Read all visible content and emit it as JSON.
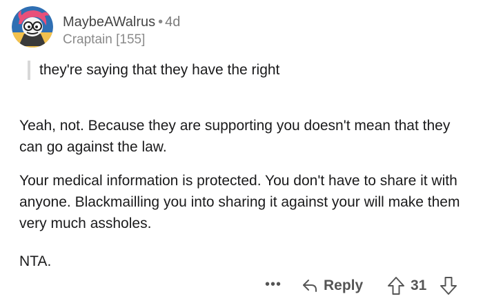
{
  "comment": {
    "author": {
      "username": "MaybeAWalrus",
      "separator": "•",
      "age": "4d",
      "flair": "Craptain [155]"
    },
    "quote": "they're saying that they have the right",
    "paragraphs": [
      "Yeah, not. Because they are supporting you doesn't mean that they can go against the law.",
      "Your medical information is protected. You don't have to share it with anyone. Blackmailling you into sharing it against your will make them very much assholes.",
      "NTA."
    ],
    "actions": {
      "more_label": "•••",
      "reply_label": "Reply",
      "reply_icon": "reply-arrow-icon",
      "upvote_icon": "upvote-arrow-icon",
      "score": "31",
      "downvote_icon": "downvote-arrow-icon"
    },
    "colors": {
      "text": "#1a1a1b",
      "muted": "#7c7c7c",
      "quote_bar": "#d8d8d8",
      "avatar_bg": "#2f6fb3",
      "avatar_hair": "#e8507a"
    }
  }
}
